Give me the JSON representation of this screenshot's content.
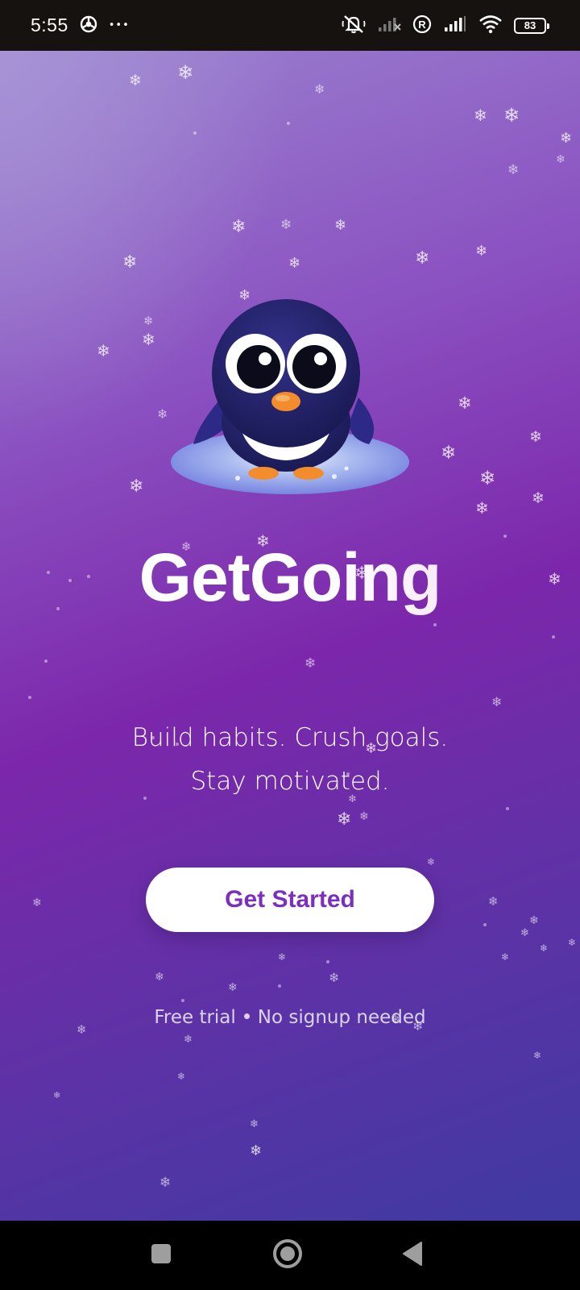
{
  "status_bar": {
    "time": "5:55",
    "more_indicator": "•••",
    "battery_level": "83",
    "icons": [
      "chrome-icon",
      "mute-icon",
      "signal-off-icon",
      "roaming-icon",
      "signal-icon",
      "wifi-icon",
      "battery-icon"
    ]
  },
  "app": {
    "title": "GetGoing",
    "tagline_line1": "Build habits. Crush goals.",
    "tagline_line2": "Stay motivated.",
    "cta_label": "Get Started",
    "footnote_left": "Free trial",
    "footnote_right": "No signup needed",
    "mascot_icon": "penguin-icon",
    "decoration_icon": "snowflake-icon"
  },
  "colors": {
    "gradient_top_left": "#9a82cf",
    "gradient_mid": "#7c27ab",
    "gradient_bottom_right": "#3f3aa2",
    "cta_text": "#7a2fc0",
    "cta_background": "#ffffff",
    "penguin_body": "#24236b",
    "penguin_beak": "#f28c2c",
    "status_bar": "#15120f",
    "nav_bar": "#000000"
  },
  "nav_bar": {
    "buttons": [
      "recents-icon",
      "home-icon",
      "back-icon"
    ]
  }
}
